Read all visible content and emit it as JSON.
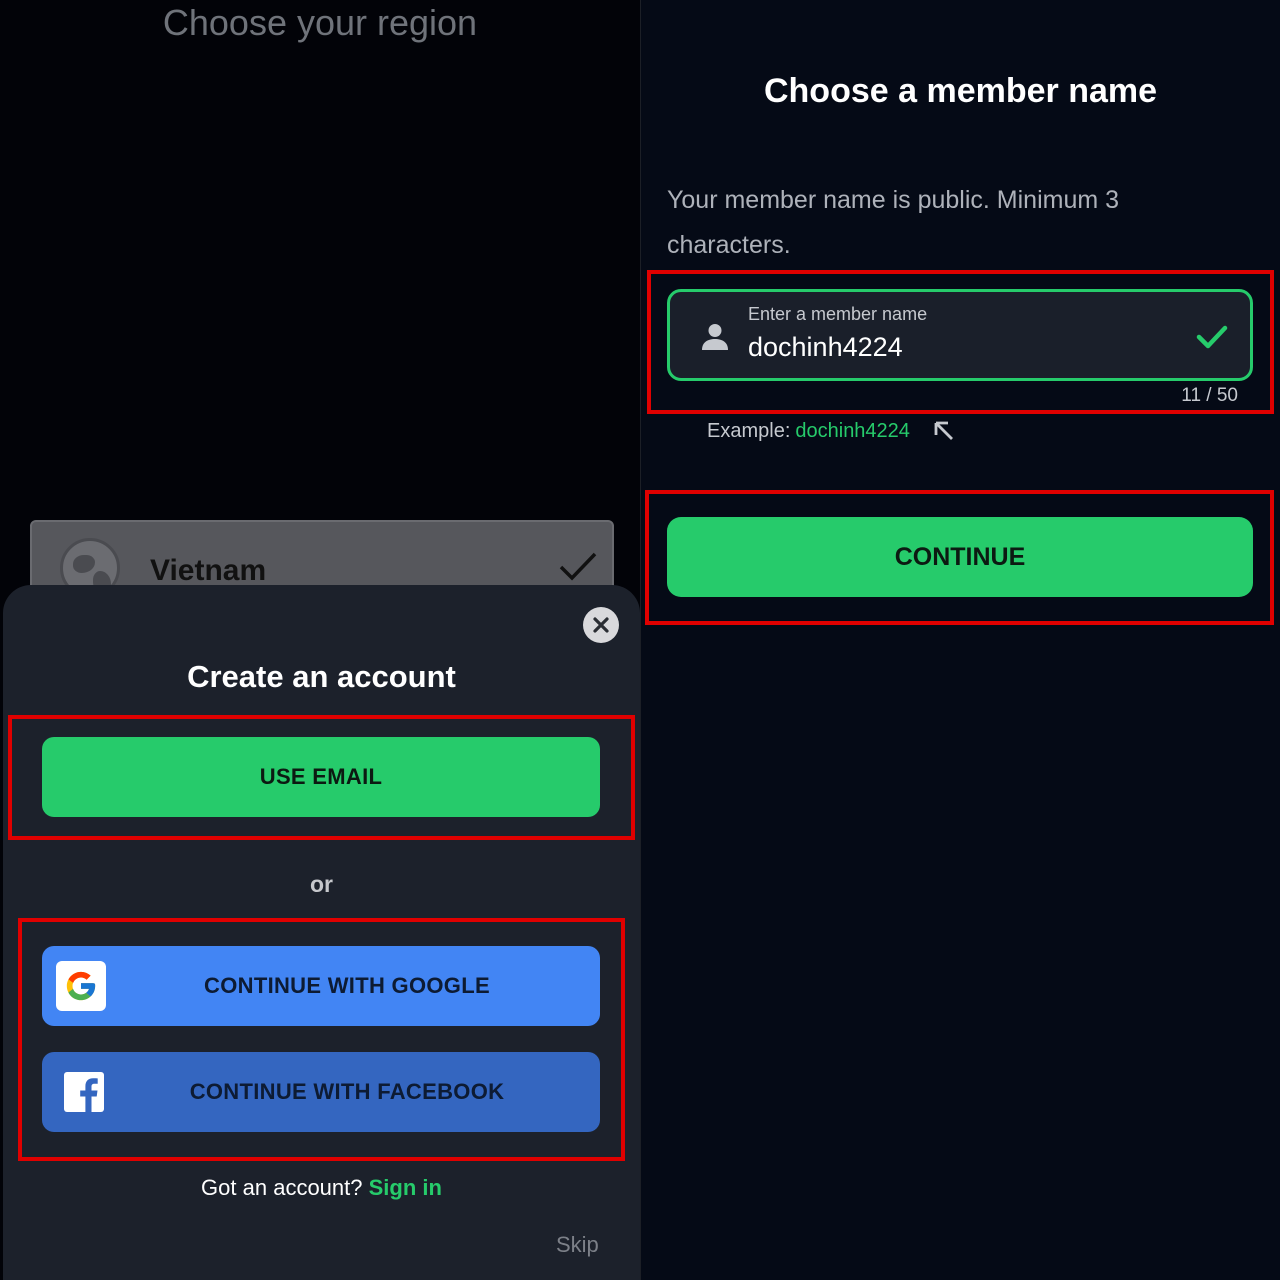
{
  "region_screen": {
    "title": "Choose your region",
    "selected_region": "Vietnam"
  },
  "account_sheet": {
    "title": "Create an account",
    "use_email_label": "USE EMAIL",
    "or_label": "or",
    "google_label": "CONTINUE WITH GOOGLE",
    "facebook_label": "CONTINUE WITH FACEBOOK",
    "signin_prompt": "Got an account?",
    "signin_link": "Sign in",
    "skip_label": "Skip"
  },
  "member_screen": {
    "title": "Choose a member name",
    "description": "Your member name is public. Minimum 3 characters.",
    "input_label": "Enter a member name",
    "input_value": "dochinh4224",
    "counter": "11 / 50",
    "example_label": "Example:",
    "example_value": "dochinh4224",
    "continue_label": "CONTINUE"
  },
  "colors": {
    "accent_green": "#26cb6b",
    "google_blue": "#4285f4",
    "facebook_blue": "#3466c0",
    "highlight_red": "#e00000"
  }
}
